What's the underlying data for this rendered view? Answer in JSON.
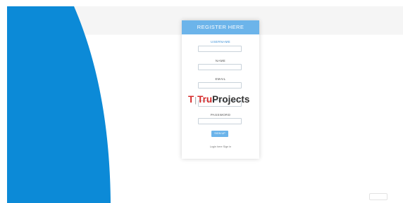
{
  "form": {
    "header": "REGISTER HERE",
    "fields": [
      {
        "label": "USERNAME",
        "value": ""
      },
      {
        "label": "NAME",
        "value": ""
      },
      {
        "label": "EMAIL",
        "value": ""
      },
      {
        "label": "",
        "value": ""
      },
      {
        "label": "PASSWORD",
        "value": ""
      }
    ],
    "signup_label": "SIGN UP",
    "login_link": "Login here Sign in"
  },
  "watermark": {
    "t": "T",
    "tru": "Tru",
    "projects": "Projects"
  },
  "colors": {
    "blue_shape": "#0c8ad7",
    "header": "#6cb4ea"
  }
}
